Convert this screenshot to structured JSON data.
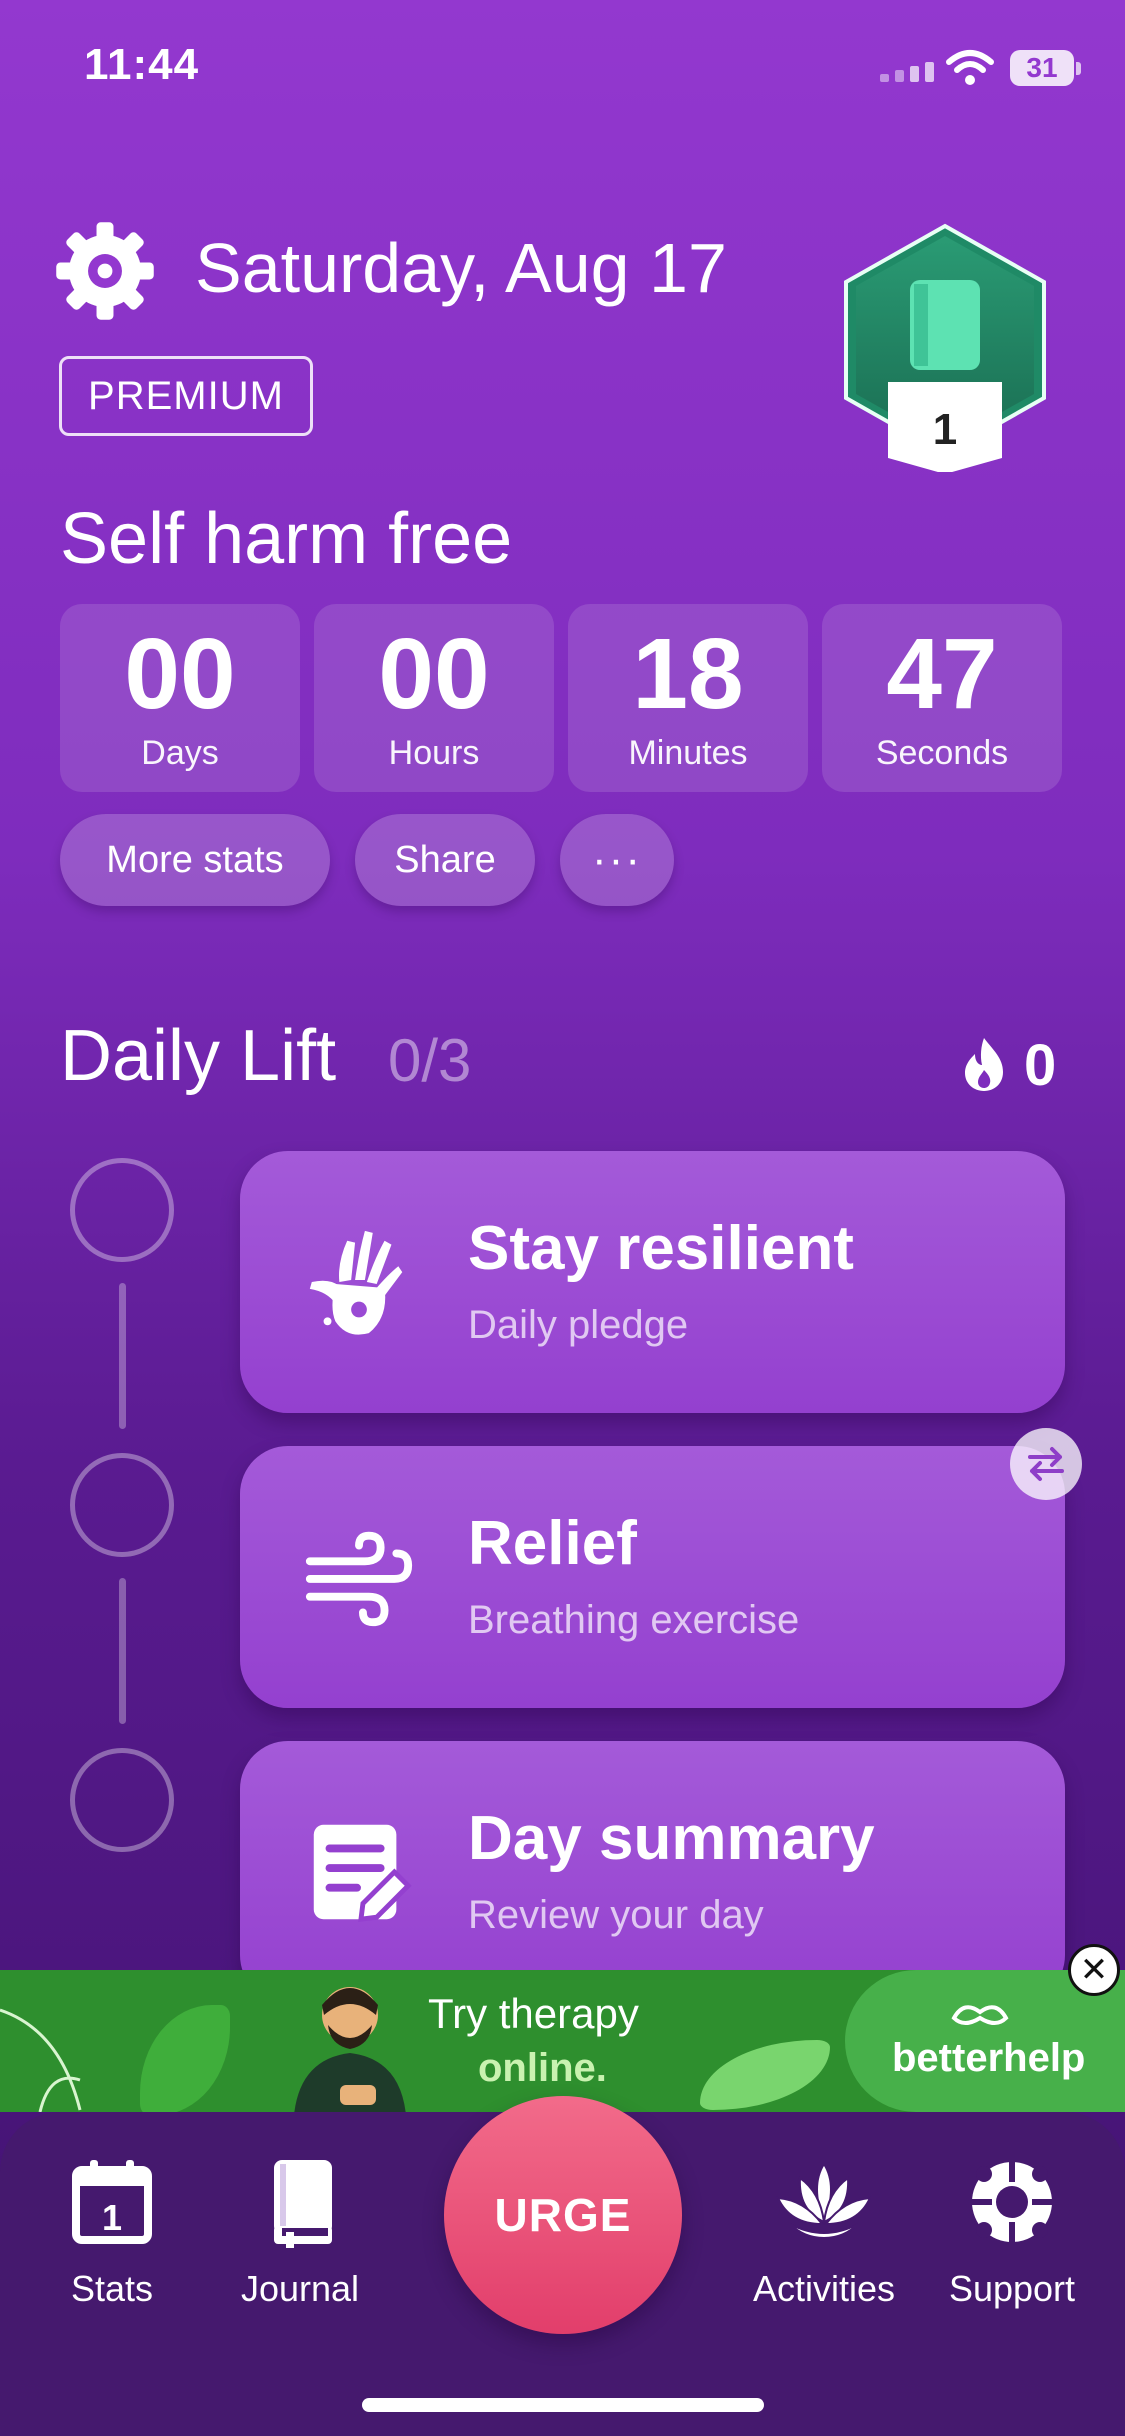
{
  "status_bar": {
    "time": "11:44",
    "battery": "31"
  },
  "header": {
    "date": "Saturday, Aug 17",
    "premium_label": "PREMIUM",
    "badge_level": "1"
  },
  "streak": {
    "title": "Self harm free",
    "counters": [
      {
        "value": "00",
        "unit": "Days"
      },
      {
        "value": "00",
        "unit": "Hours"
      },
      {
        "value": "18",
        "unit": "Minutes"
      },
      {
        "value": "47",
        "unit": "Seconds"
      }
    ],
    "buttons": {
      "more_stats": "More stats",
      "share": "Share",
      "more": "···"
    }
  },
  "daily_lift": {
    "title": "Daily Lift",
    "progress": "0/3",
    "streak_count": "0",
    "tasks": [
      {
        "title": "Stay resilient",
        "subtitle": "Daily pledge",
        "icon": "hand-icon"
      },
      {
        "title": "Relief",
        "subtitle": "Breathing exercise",
        "icon": "wind-icon"
      },
      {
        "title": "Day summary",
        "subtitle": "Review your day",
        "icon": "document-edit-icon"
      }
    ]
  },
  "ad": {
    "line1": "Try therapy",
    "line2": "online.",
    "brand": "betterhelp",
    "close": "✕"
  },
  "tabbar": {
    "stats": "Stats",
    "stats_day": "1",
    "journal": "Journal",
    "urge": "URGE",
    "activities": "Activities",
    "support": "Support"
  },
  "colors": {
    "background": "#9338cf",
    "urge": "#e23e6b",
    "ad_green": "#2e8f2e",
    "tabbar": "#45196e"
  }
}
